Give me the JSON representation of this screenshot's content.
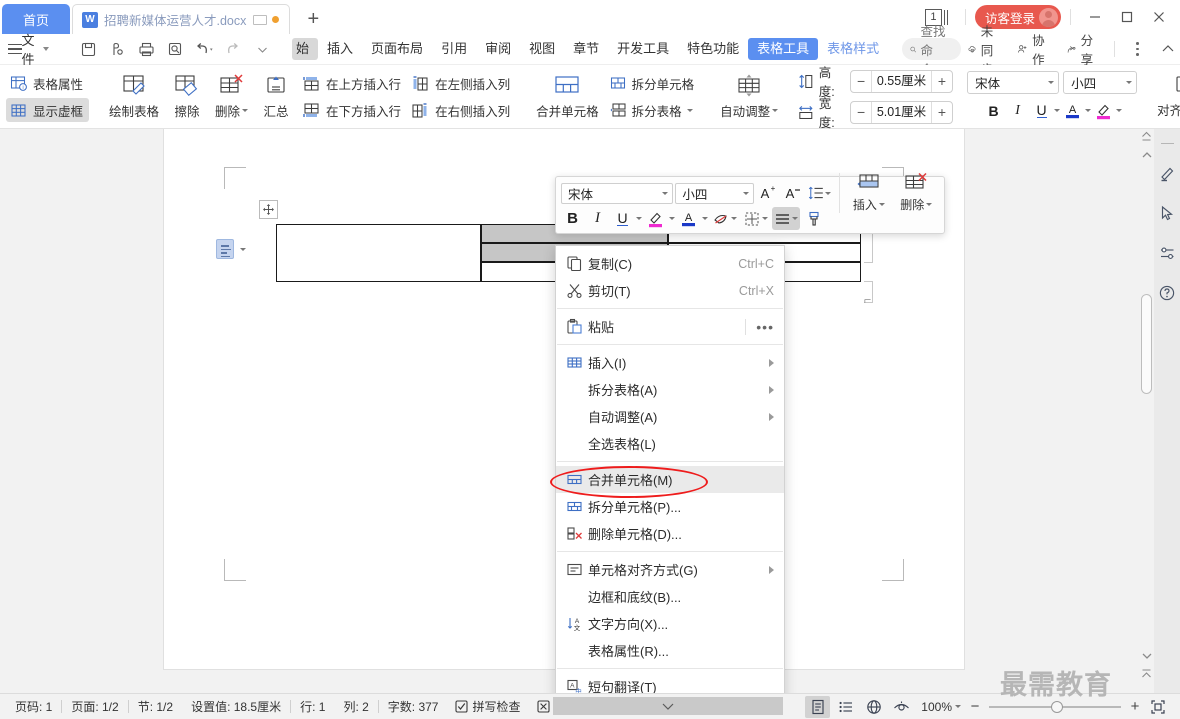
{
  "titlebar": {
    "home_tab": "首页",
    "doc_tab": {
      "icon": "wps-word-icon",
      "title": "招聘新媒体运营人才.docx",
      "monitor_icon": "monitor-icon",
      "unsaved_dot": "unsaved-dot"
    },
    "new_tab_icon": "plus-icon",
    "page_count": "1",
    "login_label": "访客登录",
    "minimize": "—",
    "maximize": "▢",
    "close": "✕",
    "accent_blue": "#5b8ff0",
    "login_red": "#e8584e"
  },
  "menubar": {
    "file_label": "文件",
    "quick_icons": [
      "save-icon",
      "print-preview-icon",
      "print-icon",
      "search-doc-icon",
      "undo-icon",
      "redo-icon",
      "customize-qat-icon"
    ],
    "tabs": [
      {
        "label": "始",
        "state": "partial"
      },
      {
        "label": "插入",
        "state": "normal"
      },
      {
        "label": "页面布局",
        "state": "normal"
      },
      {
        "label": "引用",
        "state": "normal"
      },
      {
        "label": "审阅",
        "state": "normal"
      },
      {
        "label": "视图",
        "state": "normal"
      },
      {
        "label": "章节",
        "state": "normal"
      },
      {
        "label": "开发工具",
        "state": "normal"
      },
      {
        "label": "特色功能",
        "state": "normal"
      },
      {
        "label": "表格工具",
        "state": "active"
      },
      {
        "label": "表格样式",
        "state": "style"
      }
    ],
    "find_command": "查找命令...",
    "sync_label": "未同步",
    "collab_label": "协作",
    "share_label": "分享",
    "more_icon": "more-vertical-icon",
    "collapse_icon": "chevron-up-icon"
  },
  "ribbon": {
    "table_props": "表格属性",
    "show_gridlines": "显示虚框",
    "draw_table": "绘制表格",
    "eraser": "擦除",
    "delete": "删除",
    "sum": "汇总",
    "insert_row_above": "在上方插入行",
    "insert_row_below": "在下方插入行",
    "insert_col_left": "在左侧插入列",
    "insert_col_right": "在右侧插入列",
    "merge_cells": "合并单元格",
    "split_cells": "拆分单元格",
    "split_table": "拆分表格",
    "autofit": "自动调整",
    "height_label": "高度:",
    "height_value": "0.55厘米",
    "width_label": "宽度:",
    "width_value": "5.01厘米",
    "font_name": "宋体",
    "font_size": "小四",
    "bold": "B",
    "italic": "I",
    "underline": "U",
    "font_color_icon": "font-color-icon",
    "highlight_icon": "highlight-icon",
    "align_label": "对齐方式",
    "text_label": "文"
  },
  "mini_toolbar": {
    "font_name": "宋体",
    "font_size": "小四",
    "grow_font": "A",
    "shrink_font": "A",
    "line_spacing_icon": "line-spacing-icon",
    "bold": "B",
    "italic": "I",
    "underline": "U",
    "highlight_icon": "highlight-icon",
    "font_color_icon": "font-color-icon",
    "shading_icon": "cell-shading-icon",
    "borders_icon": "borders-icon",
    "align_icon": "align-icon",
    "format_painter_icon": "format-painter-icon",
    "insert_label": "插入",
    "delete_label": "删除"
  },
  "context_menu": {
    "items": [
      {
        "icon": "copy-icon",
        "label": "复制(C)",
        "shortcut": "Ctrl+C",
        "submenu": false,
        "highlight": false,
        "sep_after": false
      },
      {
        "icon": "cut-icon",
        "label": "剪切(T)",
        "shortcut": "Ctrl+X",
        "submenu": false,
        "highlight": false,
        "sep_after": true
      },
      {
        "icon": "paste-icon",
        "label": "粘贴",
        "shortcut": "",
        "submenu": false,
        "highlight": false,
        "sep_after": true,
        "more": "•••"
      },
      {
        "icon": "insert-table-icon",
        "label": "插入(I)",
        "shortcut": "",
        "submenu": true,
        "highlight": false,
        "sep_after": false
      },
      {
        "icon": "",
        "label": "拆分表格(A)",
        "shortcut": "",
        "submenu": true,
        "highlight": false,
        "sep_after": false
      },
      {
        "icon": "",
        "label": "自动调整(A)",
        "shortcut": "",
        "submenu": true,
        "highlight": false,
        "sep_after": false
      },
      {
        "icon": "",
        "label": "全选表格(L)",
        "shortcut": "",
        "submenu": false,
        "highlight": false,
        "sep_after": true
      },
      {
        "icon": "merge-cells-icon",
        "label": "合并单元格(M)",
        "shortcut": "",
        "submenu": false,
        "highlight": true,
        "sep_after": false
      },
      {
        "icon": "split-cells-icon",
        "label": "拆分单元格(P)...",
        "shortcut": "",
        "submenu": false,
        "highlight": false,
        "sep_after": false
      },
      {
        "icon": "delete-cells-icon",
        "label": "删除单元格(D)...",
        "shortcut": "",
        "submenu": false,
        "highlight": false,
        "sep_after": true
      },
      {
        "icon": "cell-align-icon",
        "label": "单元格对齐方式(G)",
        "shortcut": "",
        "submenu": true,
        "highlight": false,
        "sep_after": false
      },
      {
        "icon": "",
        "label": "边框和底纹(B)...",
        "shortcut": "",
        "submenu": false,
        "highlight": false,
        "sep_after": false
      },
      {
        "icon": "text-direction-icon",
        "label": "文字方向(X)...",
        "shortcut": "",
        "submenu": false,
        "highlight": false,
        "sep_after": false
      },
      {
        "icon": "",
        "label": "表格属性(R)...",
        "shortcut": "",
        "submenu": false,
        "highlight": false,
        "sep_after": true
      },
      {
        "icon": "translate-icon",
        "label": "短句翻译(T)",
        "shortcut": "",
        "submenu": false,
        "highlight": false,
        "sep_after": false
      }
    ],
    "annotation_color": "#ee1c1c"
  },
  "document": {
    "move_handle_icon": "table-move-handle-icon",
    "paste_options_icon": "paste-options-icon",
    "watermark": "最需教育",
    "float_chevron_icon": "chevron-down-icon"
  },
  "right_sidebar": {
    "icons": [
      "pen-icon",
      "cursor-select-icon",
      "settings-sliders-icon",
      "help-icon"
    ]
  },
  "scrollbar": {
    "up_icon": "scroll-up-icon",
    "down_icon": "scroll-down-icon",
    "prev_page_icon": "prev-page-icon",
    "next_page_icon": "next-page-icon"
  },
  "statusbar": {
    "page_no": "页码: 1",
    "page_of": "页面: 1/2",
    "section": "节: 1/2",
    "setting": "设置值: 18.5厘米",
    "row": "行: 1",
    "col": "列: 2",
    "word_count": "字数: 377",
    "spellcheck": "拼写检查",
    "doc_label": "文",
    "views": [
      "page-view-icon",
      "outline-view-icon",
      "web-view-icon",
      "reading-view-icon"
    ],
    "zoom_level": "100%",
    "zoom_minus": "—",
    "zoom_plus": "+",
    "fullscreen_icon": "fullscreen-icon"
  }
}
